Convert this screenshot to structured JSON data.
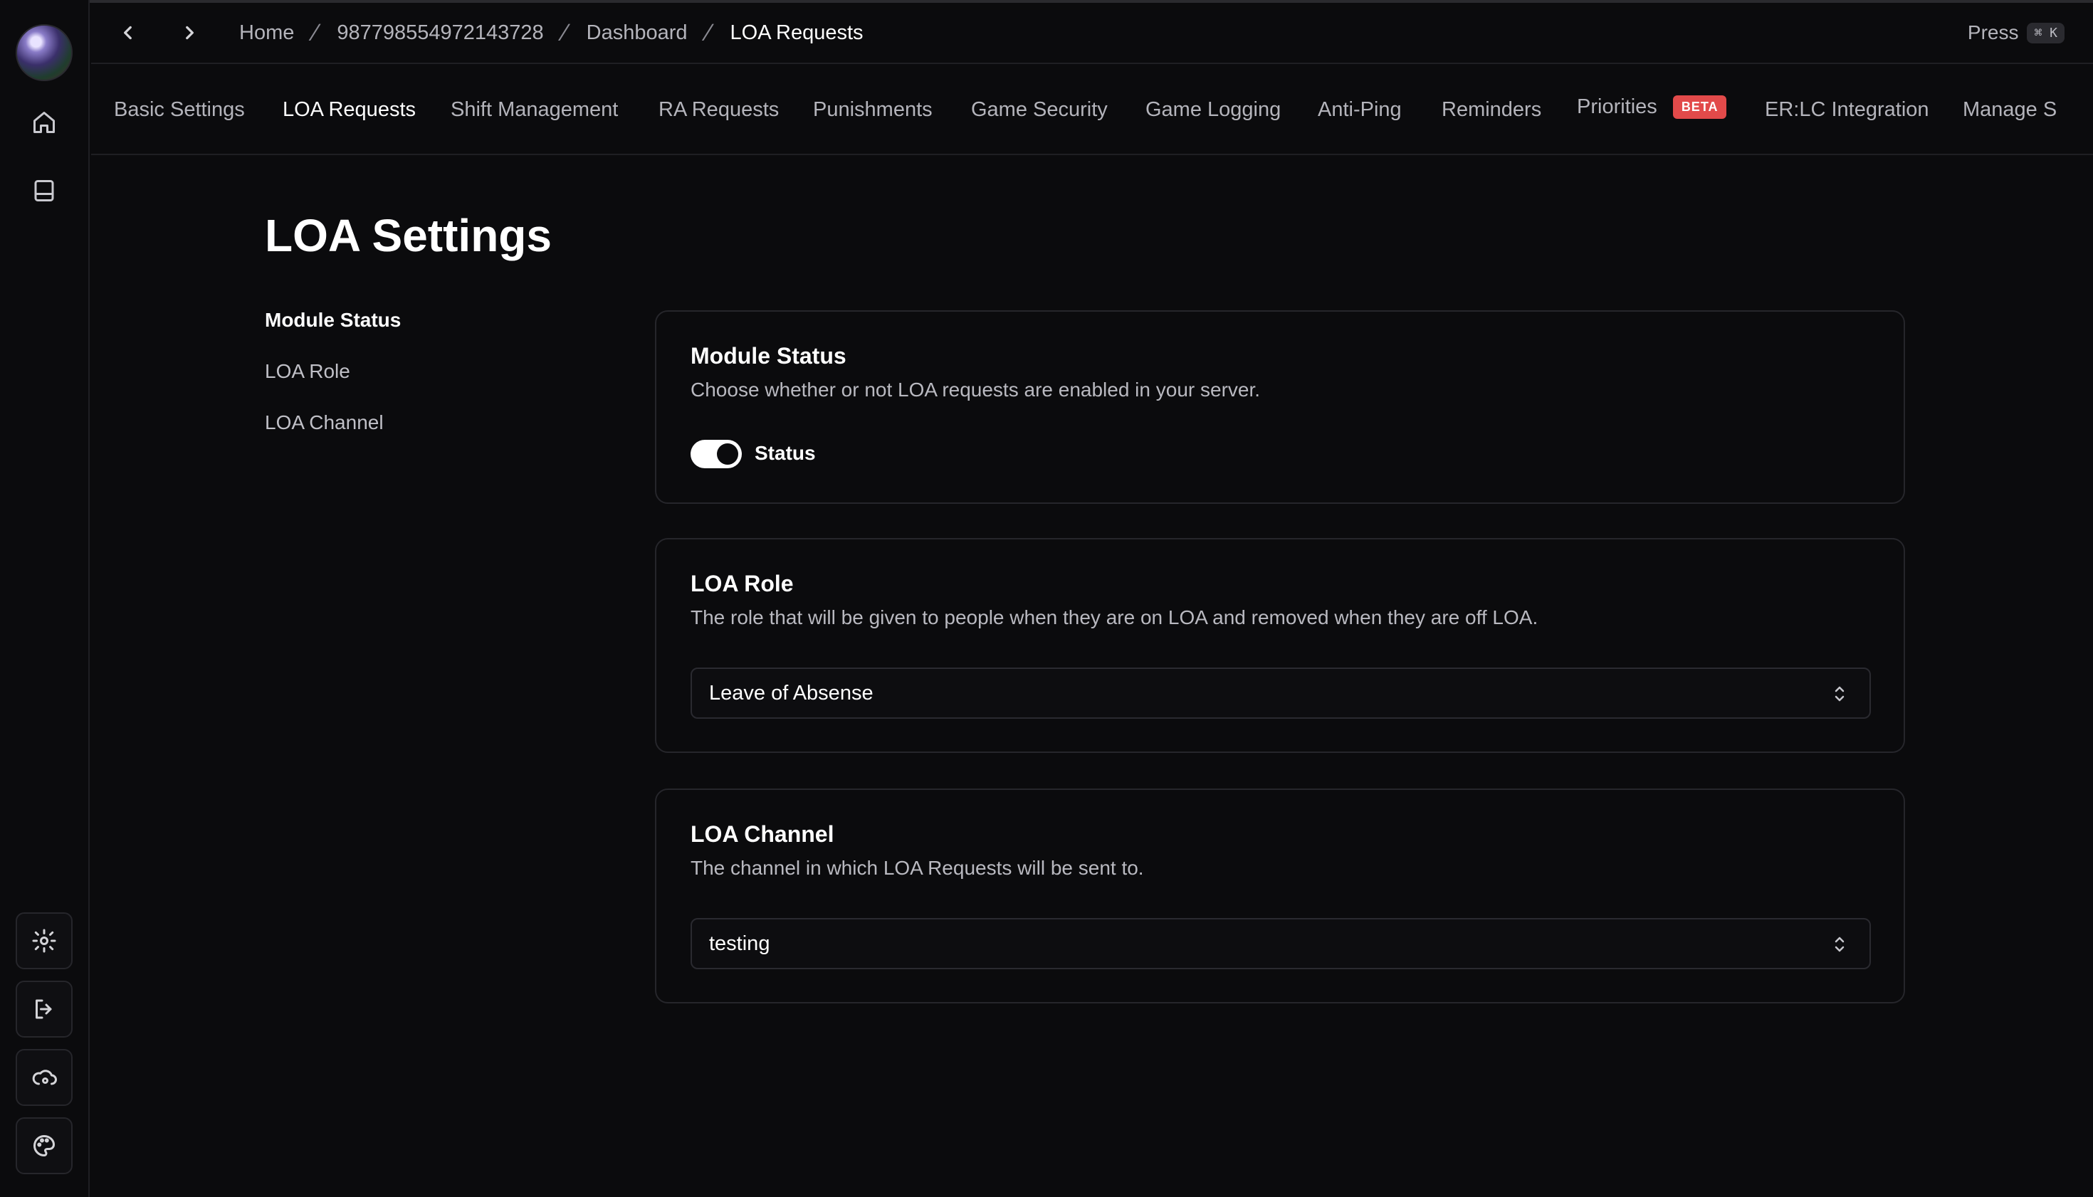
{
  "header": {
    "breadcrumbs": [
      "Home",
      "987798554972143728",
      "Dashboard",
      "LOA Requests"
    ],
    "press_label": "Press",
    "shortcut": "⌘ K"
  },
  "tabs": [
    {
      "label": "Basic Settings"
    },
    {
      "label": "LOA Requests",
      "active": true
    },
    {
      "label": "Shift Management"
    },
    {
      "label": "RA Requests"
    },
    {
      "label": "Punishments"
    },
    {
      "label": "Game Security"
    },
    {
      "label": "Game Logging"
    },
    {
      "label": "Anti-Ping"
    },
    {
      "label": "Reminders"
    },
    {
      "label": "Priorities",
      "badge": "BETA"
    },
    {
      "label": "ER:LC Integration"
    },
    {
      "label": "Manage S"
    }
  ],
  "page": {
    "title": "LOA Settings",
    "sidenav": [
      "Module Status",
      "LOA Role",
      "LOA Channel"
    ]
  },
  "module_status": {
    "title": "Module Status",
    "description": "Choose whether or not LOA requests are enabled in your server.",
    "toggle_label": "Status",
    "enabled": true
  },
  "loa_role": {
    "title": "LOA Role",
    "description": "The role that will be given to people when they are on LOA and removed when they are off LOA.",
    "selected": "Leave of Absense"
  },
  "loa_channel": {
    "title": "LOA Channel",
    "description": "The channel in which LOA Requests will be sent to.",
    "selected": "testing"
  },
  "colors": {
    "background": "#0b0b0d",
    "beta_badge": "#e24a4a",
    "border": "#26262b"
  },
  "icons": [
    "home-icon",
    "panel-icon",
    "settings-gear-icon",
    "logout-icon",
    "cloud-settings-icon",
    "palette-icon",
    "chevron-left-icon",
    "chevron-right-icon",
    "chevron-updown-icon"
  ]
}
